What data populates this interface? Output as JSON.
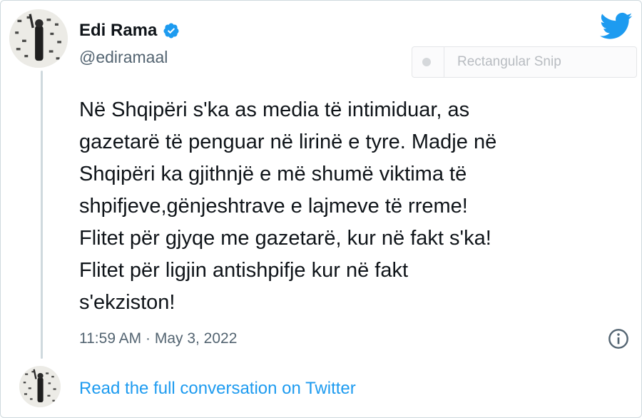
{
  "author": {
    "name": "Edi Rama",
    "handle": "@ediramaal",
    "verified_icon": "verified-badge-icon"
  },
  "brand": {
    "logo_icon": "twitter-bird-icon",
    "accent_color": "#1d9bf0"
  },
  "overlay": {
    "label": "Rectangular Snip"
  },
  "tweet": {
    "text": "Në Shqipëri s'ka as media të intimiduar, as\ngazetarë të penguar në lirinë e tyre. Madje në\nShqipëri ka gjithnjë e më shumë viktima të\nshpifjeve,gënjeshtrave e lajmeve të rreme!\nFlitet për gjyqe me gazetarë, kur në fakt s'ka!\nFlitet për ligjin antishpifje kur në fakt\ns'ekziston!",
    "timestamp": "11:59 AM · May 3, 2022"
  },
  "footer": {
    "link_label": "Read the full conversation on Twitter"
  }
}
